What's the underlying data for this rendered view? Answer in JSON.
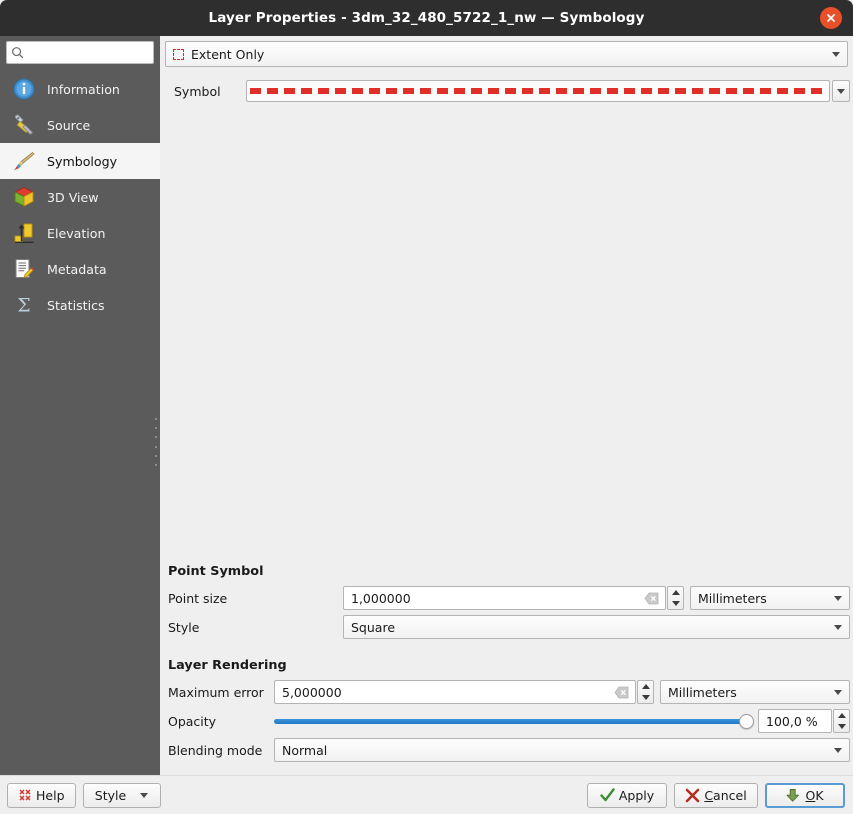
{
  "window": {
    "title": "Layer Properties - 3dm_32_480_5722_1_nw — Symbology",
    "close_icon": "close-icon"
  },
  "sidebar": {
    "search": {
      "value": "",
      "placeholder": "",
      "icon": "search-icon"
    },
    "items": [
      {
        "label": "Information",
        "icon": "information-icon",
        "selected": false
      },
      {
        "label": "Source",
        "icon": "source-wrench-icon",
        "selected": false
      },
      {
        "label": "Symbology",
        "icon": "symbology-brush-icon",
        "selected": true
      },
      {
        "label": "3D View",
        "icon": "cube-3d-icon",
        "selected": false
      },
      {
        "label": "Elevation",
        "icon": "elevation-arrow-icon",
        "selected": false
      },
      {
        "label": "Metadata",
        "icon": "metadata-pencil-icon",
        "selected": false
      },
      {
        "label": "Statistics",
        "icon": "sigma-statistics-icon",
        "selected": false
      }
    ]
  },
  "main": {
    "render_type": {
      "label": "Extent Only",
      "icon": "dashed-extent-icon"
    },
    "symbol": {
      "label": "Symbol",
      "preview": "red-dashed-line",
      "color": "#e02f28"
    },
    "point_symbol": {
      "title": "Point Symbol",
      "point_size": {
        "label": "Point size",
        "value": "1,000000",
        "unit": "Millimeters",
        "clear_icon": "clear-icon"
      },
      "style": {
        "label": "Style",
        "value": "Square"
      }
    },
    "layer_rendering": {
      "title": "Layer Rendering",
      "maximum_error": {
        "label": "Maximum error",
        "value": "5,000000",
        "unit": "Millimeters",
        "clear_icon": "clear-icon"
      },
      "opacity": {
        "label": "Opacity",
        "value": "100,0 %",
        "percent": 100
      },
      "blending_mode": {
        "label": "Blending mode",
        "value": "Normal"
      }
    }
  },
  "buttons": {
    "help": "Help",
    "style": "Style",
    "apply": "Apply",
    "cancel": "Cancel",
    "ok": "OK"
  },
  "colors": {
    "titlebar": "#2e2e2e",
    "sidebar": "#5b5b5b",
    "panel": "#efefef",
    "accent_slider": "#2a7fc9",
    "symbol_red": "#e02f28",
    "close_button": "#e8502a",
    "focus_blue": "#5b9bd5"
  }
}
